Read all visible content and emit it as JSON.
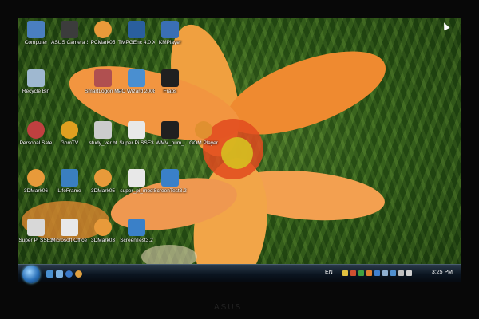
{
  "desktop": {
    "icons": [
      {
        "label": "Computer",
        "icon": "computer-icon",
        "color": "#4a7fc0"
      },
      {
        "label": "ASUS Camera ScreenSaver",
        "icon": "camera-icon",
        "color": "#3c3c3c"
      },
      {
        "label": "PCMark05",
        "icon": "pcmark-icon",
        "color": "#e89a3a"
      },
      {
        "label": "TMPGEnc 4.0 XPress Trial",
        "icon": "tmpgenc-icon",
        "color": "#2a5f9e"
      },
      {
        "label": "KMPlayer",
        "icon": "kmplayer-icon",
        "color": "#3a6fb5"
      },
      {
        "label": "Recycle Bin",
        "icon": "recycle-bin-icon",
        "color": "#9fb8d0"
      },
      {
        "label": "SmartLogon Manager",
        "icon": "smartlogon-icon",
        "color": "#b05050"
      },
      {
        "label": "PC Wizard 2008",
        "icon": "pc-wizard-icon",
        "color": "#4a8fd0"
      },
      {
        "label": "Fraps",
        "icon": "fraps-icon",
        "color": "#202020"
      },
      {
        "label": "Personal Safe",
        "icon": "personal-safe-icon",
        "color": "#c04040"
      },
      {
        "label": "GomTV",
        "icon": "gomtv-icon",
        "color": "#e0a020"
      },
      {
        "label": "study_ver.bt",
        "icon": "file-icon",
        "color": "#cccccc"
      },
      {
        "label": "Super Pi SSE3",
        "icon": "super-pi-icon",
        "color": "#e8e8e8"
      },
      {
        "label": "WMV_num_",
        "icon": "video-file-icon",
        "color": "#202020"
      },
      {
        "label": "GOM Player",
        "icon": "gom-player-icon",
        "color": "#e09030"
      },
      {
        "label": "3DMark06",
        "icon": "3dmark06-icon",
        "color": "#e89a3a"
      },
      {
        "label": "LifeFrame",
        "icon": "lifeframe-icon",
        "color": "#3a7fc0"
      },
      {
        "label": "3DMark05",
        "icon": "3dmark05-icon",
        "color": "#e89a3a"
      },
      {
        "label": "super_pi_mod",
        "icon": "super-pi-mod-icon",
        "color": "#e8e8e8"
      },
      {
        "label": "ScreenTest3.2",
        "icon": "screentest-icon",
        "color": "#3a80c8"
      },
      {
        "label": "Super Pi SSE3",
        "icon": "super-pi-sse3-icon",
        "color": "#d8d8d8"
      },
      {
        "label": "Microsoft Office ...",
        "icon": "office-icon",
        "color": "#e8e8e8"
      },
      {
        "label": "3DMark03",
        "icon": "3dmark03-icon",
        "color": "#e89a3a"
      },
      {
        "label": "ScreenTest3.2",
        "icon": "screentest-2-icon",
        "color": "#3a80c8"
      }
    ]
  },
  "taskbar": {
    "language": "EN",
    "clock": "3:25 PM"
  },
  "bezel": {
    "brand": "ASUS"
  }
}
